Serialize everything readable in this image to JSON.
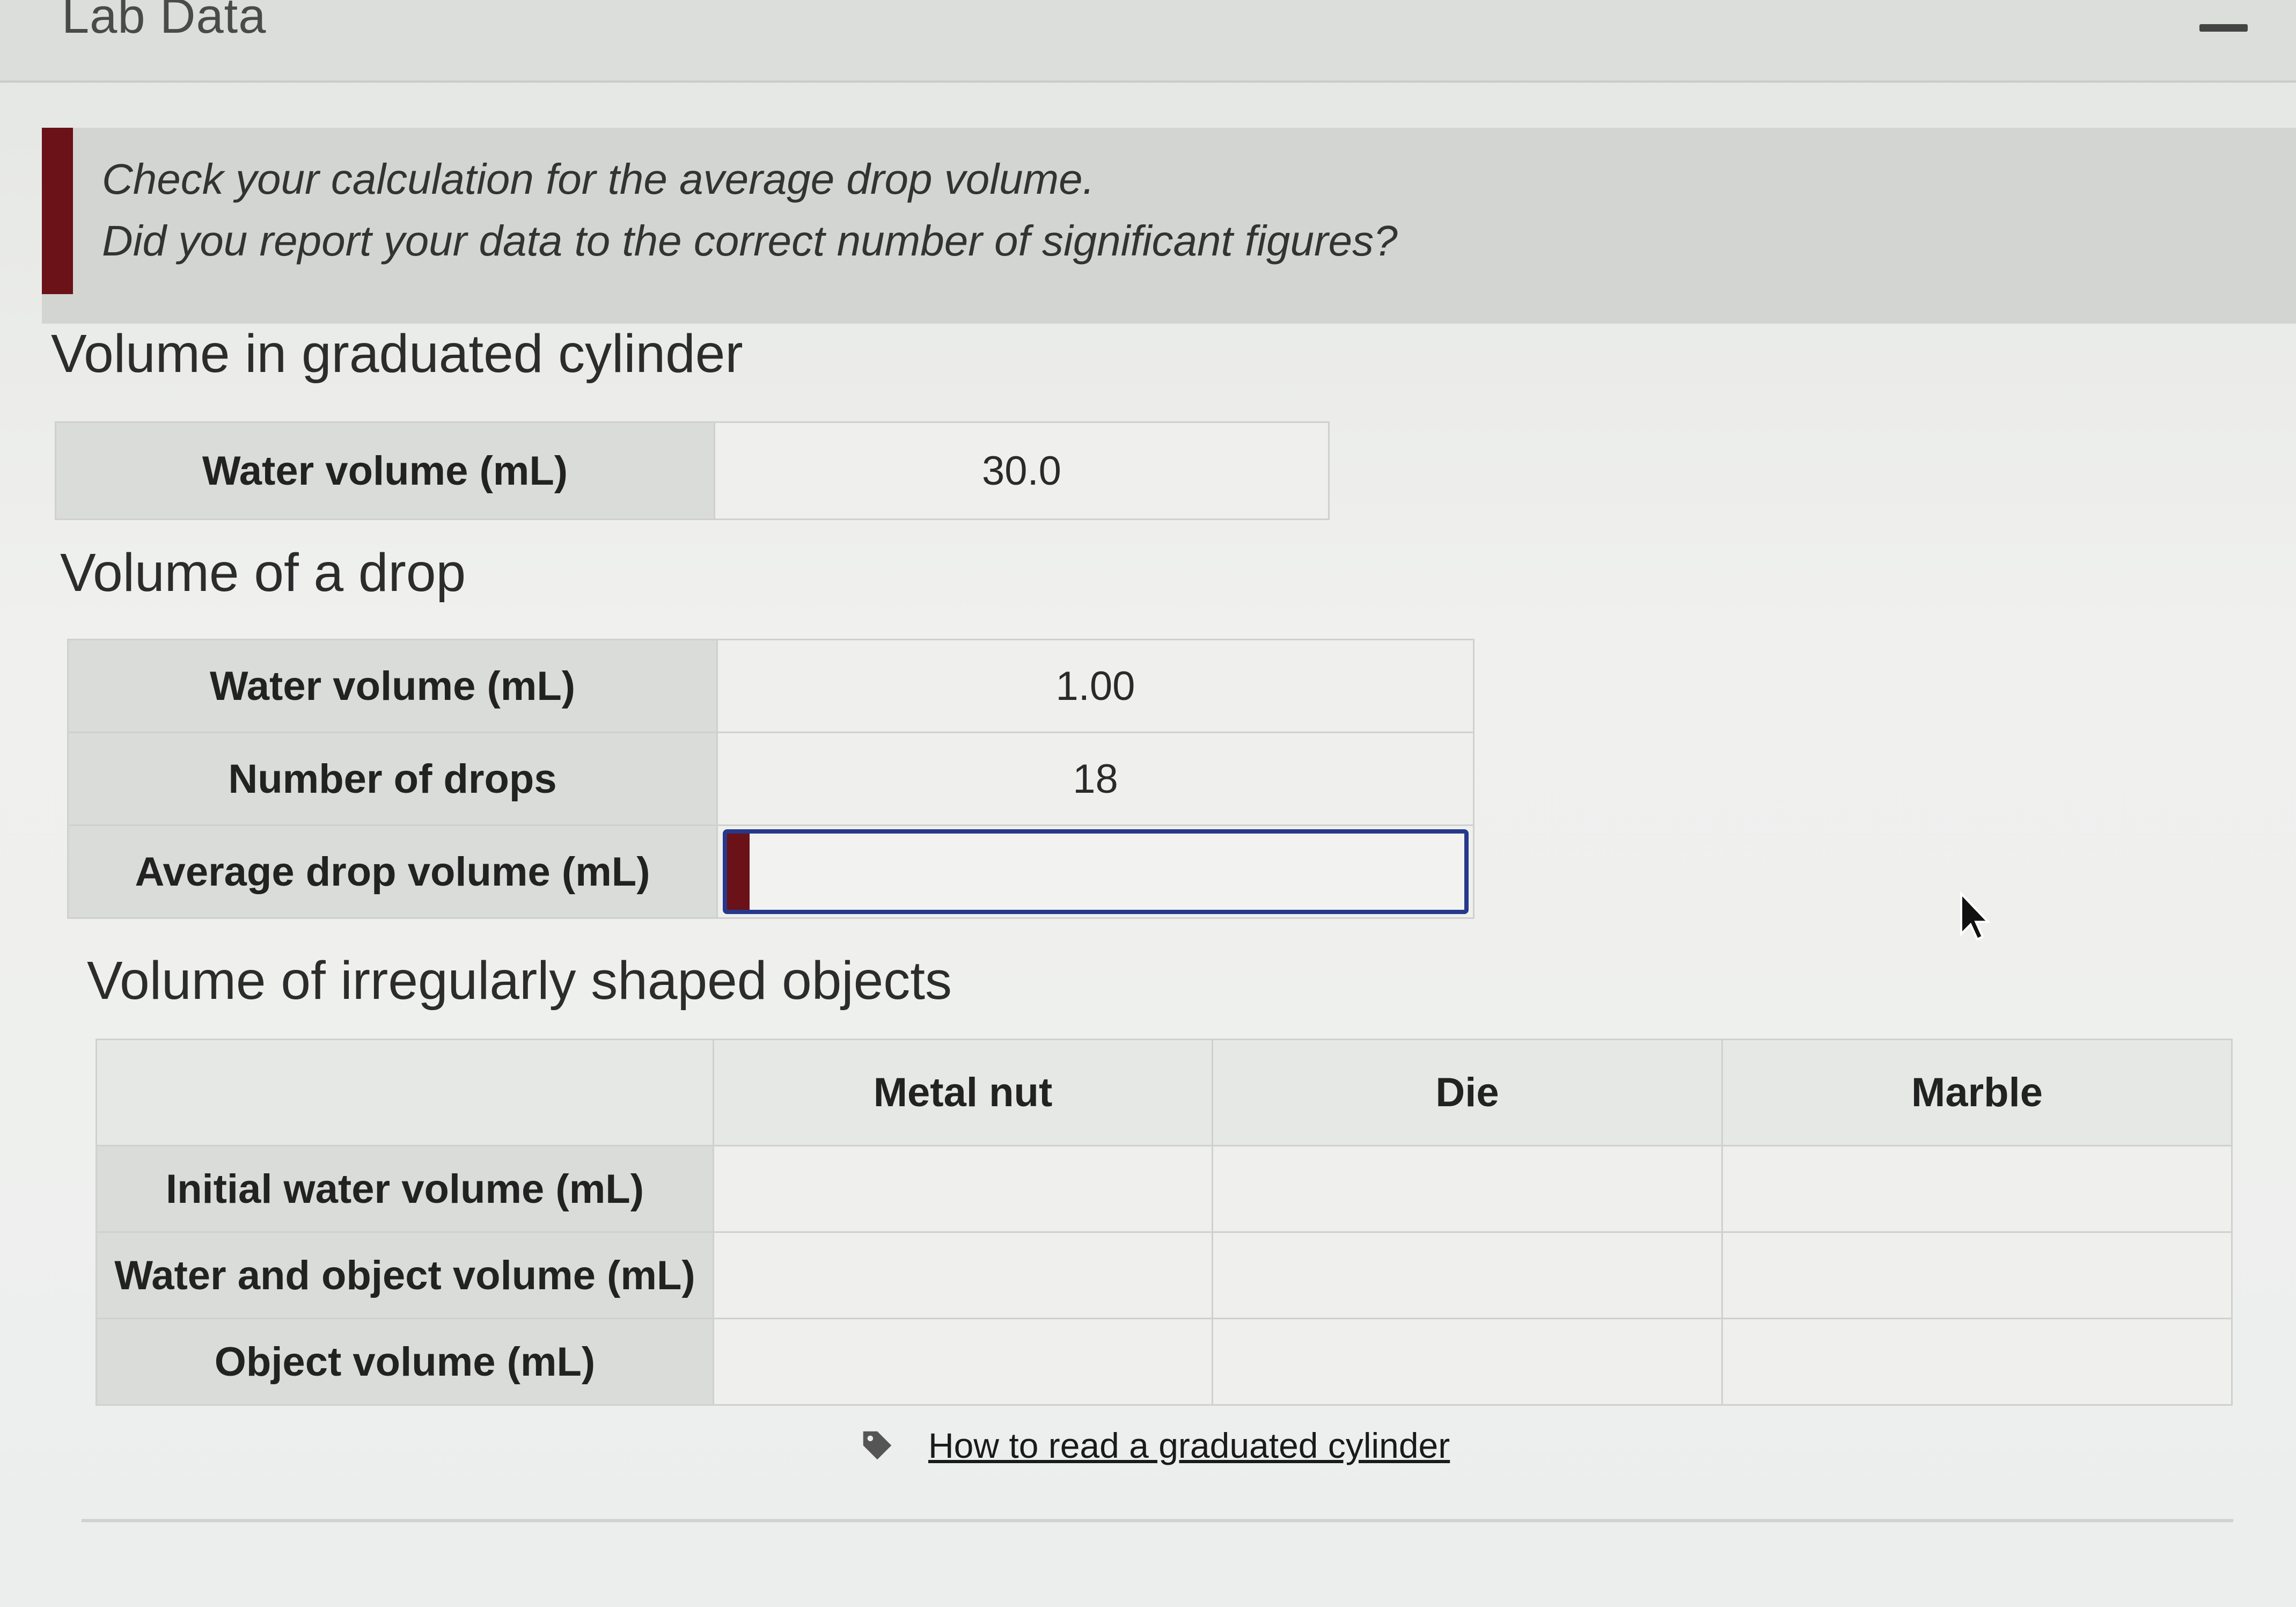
{
  "window": {
    "title": "Lab Data"
  },
  "feedback": {
    "line1": "Check your calculation for the average drop volume.",
    "line2": "Did you report your data to the correct number of significant figures?",
    "error_color": "#6b1118"
  },
  "graduated_cylinder": {
    "heading": "Volume in graduated cylinder",
    "rows": [
      {
        "label": "Water volume (mL)",
        "value": "30.0"
      }
    ]
  },
  "drop": {
    "heading": "Volume of a drop",
    "rows": [
      {
        "label": "Water volume (mL)",
        "value": "1.00"
      },
      {
        "label": "Number of drops",
        "value": "18"
      },
      {
        "label": "Average drop volume (mL)",
        "value": ""
      }
    ],
    "input_border_color": "#25398c"
  },
  "irregular": {
    "heading": "Volume of irregularly shaped objects",
    "columns": [
      "Metal nut",
      "Die",
      "Marble"
    ],
    "rows": [
      {
        "label": "Initial water volume (mL)",
        "values": [
          "",
          "",
          ""
        ]
      },
      {
        "label": "Water and object volume (mL)",
        "values": [
          "",
          "",
          ""
        ]
      },
      {
        "label": "Object volume (mL)",
        "values": [
          "",
          "",
          ""
        ]
      }
    ]
  },
  "help": {
    "link_text": "How to read a graduated cylinder",
    "icon": "tag-icon"
  }
}
